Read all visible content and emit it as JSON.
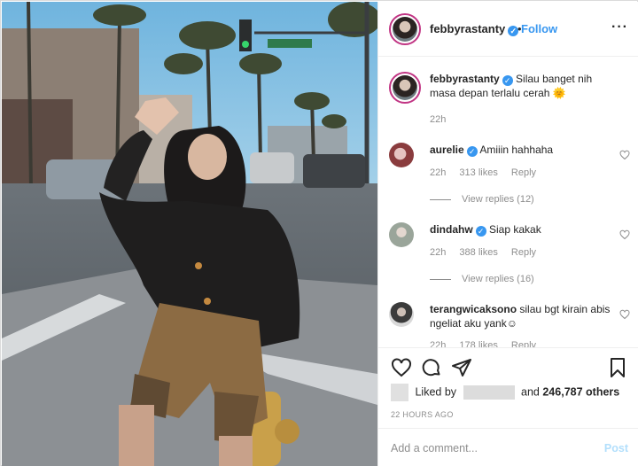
{
  "post": {
    "username": "febbyrastanty",
    "follow_label": "Follow",
    "dot": "•",
    "more_label": "···",
    "caption": "Silau banget nih masa depan terlalu cerah",
    "caption_emoji": "🌞",
    "caption_time": "22h"
  },
  "comments": [
    {
      "username": "aurelie",
      "text": "Amiiin hahhaha",
      "time": "22h",
      "likes": "313 likes",
      "reply": "Reply",
      "view_replies": "View replies (12)"
    },
    {
      "username": "dindahw",
      "text": "Siap kakak",
      "time": "22h",
      "likes": "388 likes",
      "reply": "Reply",
      "view_replies": "View replies (16)"
    },
    {
      "username": "terangwicaksono",
      "text": "silau bgt kirain abis ngeliat aku yank☺",
      "time": "22h",
      "likes": "178 likes",
      "reply": "Reply"
    }
  ],
  "actions": {
    "liked_by": "Liked by",
    "and": "and",
    "others": "246,787 others",
    "time_ago": "22 HOURS AGO"
  },
  "comment_box": {
    "placeholder": "Add a comment...",
    "post_label": "Post"
  },
  "colors": {
    "accent": "#3897f0",
    "verified": "#3897f0",
    "post_disabled": "#b2dffc",
    "muted": "#8e8e8e"
  },
  "icons": [
    "verified-badge-icon",
    "more-options-icon",
    "heart-icon",
    "comment-icon",
    "share-icon",
    "bookmark-icon"
  ]
}
